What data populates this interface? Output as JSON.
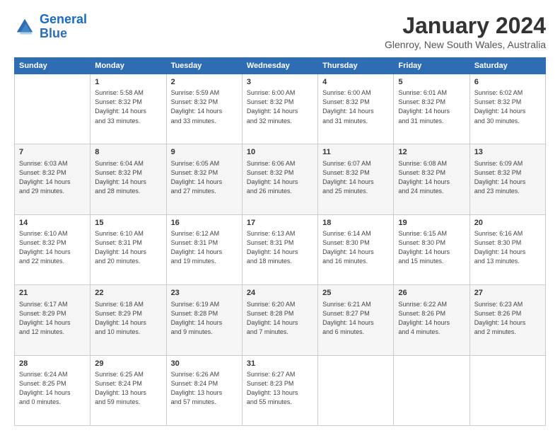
{
  "logo": {
    "line1": "General",
    "line2": "Blue"
  },
  "title": "January 2024",
  "subtitle": "Glenroy, New South Wales, Australia",
  "days_header": [
    "Sunday",
    "Monday",
    "Tuesday",
    "Wednesday",
    "Thursday",
    "Friday",
    "Saturday"
  ],
  "weeks": [
    [
      {
        "num": "",
        "info": ""
      },
      {
        "num": "1",
        "info": "Sunrise: 5:58 AM\nSunset: 8:32 PM\nDaylight: 14 hours\nand 33 minutes."
      },
      {
        "num": "2",
        "info": "Sunrise: 5:59 AM\nSunset: 8:32 PM\nDaylight: 14 hours\nand 33 minutes."
      },
      {
        "num": "3",
        "info": "Sunrise: 6:00 AM\nSunset: 8:32 PM\nDaylight: 14 hours\nand 32 minutes."
      },
      {
        "num": "4",
        "info": "Sunrise: 6:00 AM\nSunset: 8:32 PM\nDaylight: 14 hours\nand 31 minutes."
      },
      {
        "num": "5",
        "info": "Sunrise: 6:01 AM\nSunset: 8:32 PM\nDaylight: 14 hours\nand 31 minutes."
      },
      {
        "num": "6",
        "info": "Sunrise: 6:02 AM\nSunset: 8:32 PM\nDaylight: 14 hours\nand 30 minutes."
      }
    ],
    [
      {
        "num": "7",
        "info": "Sunrise: 6:03 AM\nSunset: 8:32 PM\nDaylight: 14 hours\nand 29 minutes."
      },
      {
        "num": "8",
        "info": "Sunrise: 6:04 AM\nSunset: 8:32 PM\nDaylight: 14 hours\nand 28 minutes."
      },
      {
        "num": "9",
        "info": "Sunrise: 6:05 AM\nSunset: 8:32 PM\nDaylight: 14 hours\nand 27 minutes."
      },
      {
        "num": "10",
        "info": "Sunrise: 6:06 AM\nSunset: 8:32 PM\nDaylight: 14 hours\nand 26 minutes."
      },
      {
        "num": "11",
        "info": "Sunrise: 6:07 AM\nSunset: 8:32 PM\nDaylight: 14 hours\nand 25 minutes."
      },
      {
        "num": "12",
        "info": "Sunrise: 6:08 AM\nSunset: 8:32 PM\nDaylight: 14 hours\nand 24 minutes."
      },
      {
        "num": "13",
        "info": "Sunrise: 6:09 AM\nSunset: 8:32 PM\nDaylight: 14 hours\nand 23 minutes."
      }
    ],
    [
      {
        "num": "14",
        "info": "Sunrise: 6:10 AM\nSunset: 8:32 PM\nDaylight: 14 hours\nand 22 minutes."
      },
      {
        "num": "15",
        "info": "Sunrise: 6:10 AM\nSunset: 8:31 PM\nDaylight: 14 hours\nand 20 minutes."
      },
      {
        "num": "16",
        "info": "Sunrise: 6:12 AM\nSunset: 8:31 PM\nDaylight: 14 hours\nand 19 minutes."
      },
      {
        "num": "17",
        "info": "Sunrise: 6:13 AM\nSunset: 8:31 PM\nDaylight: 14 hours\nand 18 minutes."
      },
      {
        "num": "18",
        "info": "Sunrise: 6:14 AM\nSunset: 8:30 PM\nDaylight: 14 hours\nand 16 minutes."
      },
      {
        "num": "19",
        "info": "Sunrise: 6:15 AM\nSunset: 8:30 PM\nDaylight: 14 hours\nand 15 minutes."
      },
      {
        "num": "20",
        "info": "Sunrise: 6:16 AM\nSunset: 8:30 PM\nDaylight: 14 hours\nand 13 minutes."
      }
    ],
    [
      {
        "num": "21",
        "info": "Sunrise: 6:17 AM\nSunset: 8:29 PM\nDaylight: 14 hours\nand 12 minutes."
      },
      {
        "num": "22",
        "info": "Sunrise: 6:18 AM\nSunset: 8:29 PM\nDaylight: 14 hours\nand 10 minutes."
      },
      {
        "num": "23",
        "info": "Sunrise: 6:19 AM\nSunset: 8:28 PM\nDaylight: 14 hours\nand 9 minutes."
      },
      {
        "num": "24",
        "info": "Sunrise: 6:20 AM\nSunset: 8:28 PM\nDaylight: 14 hours\nand 7 minutes."
      },
      {
        "num": "25",
        "info": "Sunrise: 6:21 AM\nSunset: 8:27 PM\nDaylight: 14 hours\nand 6 minutes."
      },
      {
        "num": "26",
        "info": "Sunrise: 6:22 AM\nSunset: 8:26 PM\nDaylight: 14 hours\nand 4 minutes."
      },
      {
        "num": "27",
        "info": "Sunrise: 6:23 AM\nSunset: 8:26 PM\nDaylight: 14 hours\nand 2 minutes."
      }
    ],
    [
      {
        "num": "28",
        "info": "Sunrise: 6:24 AM\nSunset: 8:25 PM\nDaylight: 14 hours\nand 0 minutes."
      },
      {
        "num": "29",
        "info": "Sunrise: 6:25 AM\nSunset: 8:24 PM\nDaylight: 13 hours\nand 59 minutes."
      },
      {
        "num": "30",
        "info": "Sunrise: 6:26 AM\nSunset: 8:24 PM\nDaylight: 13 hours\nand 57 minutes."
      },
      {
        "num": "31",
        "info": "Sunrise: 6:27 AM\nSunset: 8:23 PM\nDaylight: 13 hours\nand 55 minutes."
      },
      {
        "num": "",
        "info": ""
      },
      {
        "num": "",
        "info": ""
      },
      {
        "num": "",
        "info": ""
      }
    ]
  ]
}
